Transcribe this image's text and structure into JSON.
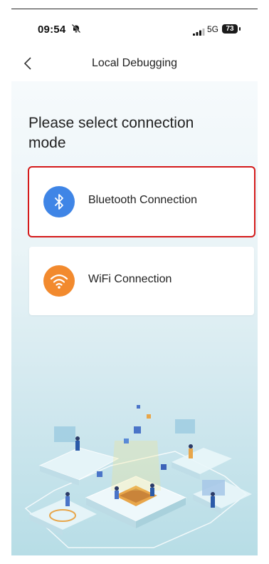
{
  "status_bar": {
    "time": "09:54",
    "silent_icon": "bell-slash-icon",
    "signal_icon": "cellular-signal-icon",
    "network": "5G",
    "battery": "73"
  },
  "nav": {
    "back_icon": "chevron-left-icon",
    "title": "Local Debugging"
  },
  "prompt": "Please select connection mode",
  "options": [
    {
      "label": "Bluetooth Connection",
      "icon": "bluetooth-icon",
      "color": "#3f85e6",
      "selected": true
    },
    {
      "label": "WiFi Connection",
      "icon": "wifi-icon",
      "color": "#f28a2e",
      "selected": false
    }
  ],
  "colors": {
    "selection_outline": "#d41a1a",
    "background_gradient": [
      "#f6fafc",
      "#b7dde6"
    ]
  }
}
